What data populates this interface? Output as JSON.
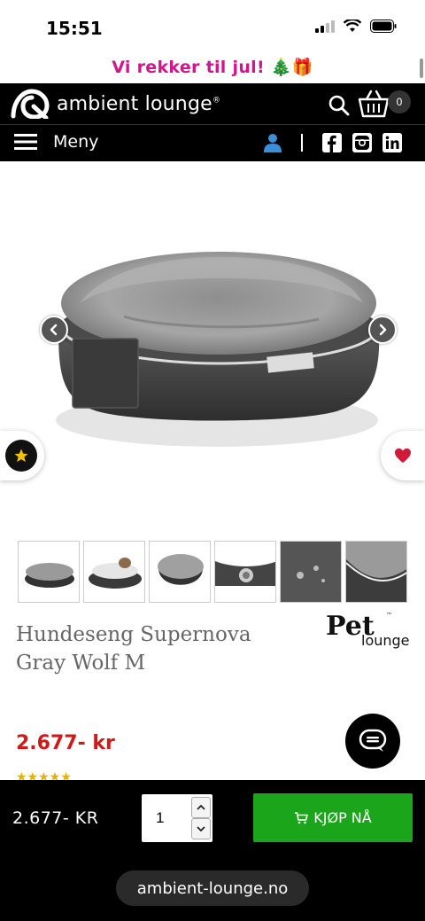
{
  "status_bar": {
    "time": "15:51"
  },
  "promo": {
    "text": "Vi rekker til jul! 🎄🎁"
  },
  "header": {
    "logo_text": "ambient lounge",
    "logo_mark": "®",
    "cart_count": "0"
  },
  "nav": {
    "menu_label": "Meny"
  },
  "product": {
    "title": "Hundeseng Supernova Gray Wolf M",
    "price": "2.677- kr",
    "brand_top": "Pet",
    "brand_bottom": "lounge",
    "brand_tm": "™",
    "thumbnails": [
      "thumb-1",
      "thumb-2",
      "thumb-3",
      "thumb-4",
      "thumb-5",
      "thumb-6"
    ]
  },
  "bottom_bar": {
    "price": "2.677- KR",
    "quantity": "1",
    "buy_label": "KJØP NÅ",
    "url": "ambient-lounge.no"
  },
  "colors": {
    "promo_pink": "#d0168a",
    "price_red": "#d01a1a",
    "buy_green": "#1aa51a"
  }
}
